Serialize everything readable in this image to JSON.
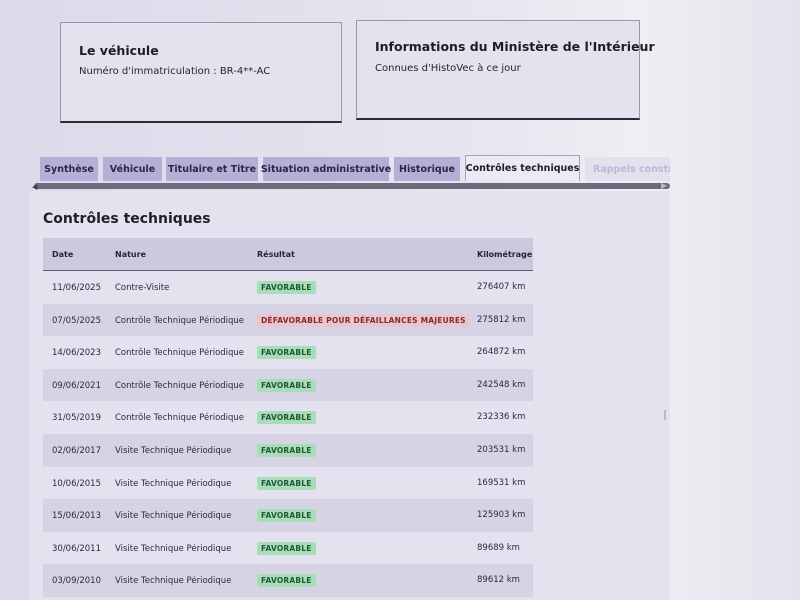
{
  "vehicle_card": {
    "title": "Le véhicule",
    "subtitle": "Numéro d'immatriculation : BR-4**-AC"
  },
  "ministry_card": {
    "title": "Informations du Ministère de l'Intérieur",
    "subtitle": "Connues d'HistoVec à ce jour"
  },
  "tabs": [
    {
      "label": "Synthèse"
    },
    {
      "label": "Véhicule"
    },
    {
      "label": "Titulaire et Titre"
    },
    {
      "label": "Situation administrative"
    },
    {
      "label": "Historique"
    },
    {
      "label": "Contrôles techniques",
      "active": true
    },
    {
      "label": "Rappels constru"
    }
  ],
  "section": {
    "title": "Contrôles techniques"
  },
  "table": {
    "headers": {
      "date": "Date",
      "nature": "Nature",
      "result": "Résultat",
      "km": "Kilométrage"
    },
    "rows": [
      {
        "date": "11/06/2025",
        "nature": "Contre-Visite",
        "result": "FAVORABLE",
        "status": "ok",
        "km": "276407 km"
      },
      {
        "date": "07/05/2025",
        "nature": "Contrôle Technique Périodique",
        "result": "DÉFAVORABLE POUR DÉFAILLANCES MAJEURES",
        "status": "ko",
        "km": "275812 km"
      },
      {
        "date": "14/06/2023",
        "nature": "Contrôle Technique Périodique",
        "result": "FAVORABLE",
        "status": "ok",
        "km": "264872 km"
      },
      {
        "date": "09/06/2021",
        "nature": "Contrôle Technique Périodique",
        "result": "FAVORABLE",
        "status": "ok",
        "km": "242548 km"
      },
      {
        "date": "31/05/2019",
        "nature": "Contrôle Technique Périodique",
        "result": "FAVORABLE",
        "status": "ok",
        "km": "232336 km"
      },
      {
        "date": "02/06/2017",
        "nature": "Visite Technique Périodique",
        "result": "FAVORABLE",
        "status": "ok",
        "km": "203531 km"
      },
      {
        "date": "10/06/2015",
        "nature": "Visite Technique Périodique",
        "result": "FAVORABLE",
        "status": "ok",
        "km": "169531 km"
      },
      {
        "date": "15/06/2013",
        "nature": "Visite Technique Périodique",
        "result": "FAVORABLE",
        "status": "ok",
        "km": "125903 km"
      },
      {
        "date": "30/06/2011",
        "nature": "Visite Technique Périodique",
        "result": "FAVORABLE",
        "status": "ok",
        "km": "89689 km"
      },
      {
        "date": "03/09/2010",
        "nature": "Visite Technique Périodique",
        "result": "FAVORABLE",
        "status": "ok",
        "km": "89612 km"
      }
    ]
  },
  "colors": {
    "accent_tab": "#b5aed6",
    "favorable_bg": "#a9dcb9",
    "unfavorable_bg": "#e9c7d2"
  },
  "icons": {
    "scroll_left": "chevron-left-icon",
    "scroll_right": "chevron-right-icon"
  }
}
